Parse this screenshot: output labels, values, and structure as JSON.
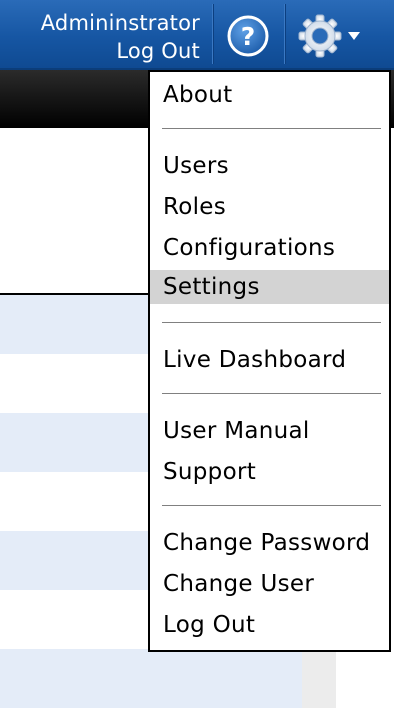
{
  "header": {
    "user_name": "Admininstrator",
    "logout_label": "Log Out",
    "help_icon": "help-icon",
    "settings_icon": "gear-icon",
    "dropdown_icon": "caret-down-icon",
    "accent_color": "#1656a3"
  },
  "menu": {
    "groups": [
      {
        "items": [
          {
            "label": "About"
          }
        ]
      },
      {
        "items": [
          {
            "label": "Users"
          },
          {
            "label": "Roles"
          },
          {
            "label": "Configurations"
          },
          {
            "label": "Settings",
            "selected": true
          }
        ]
      },
      {
        "items": [
          {
            "label": "Live Dashboard"
          }
        ]
      },
      {
        "items": [
          {
            "label": "User Manual"
          },
          {
            "label": "Support"
          }
        ]
      },
      {
        "items": [
          {
            "label": "Change Password"
          },
          {
            "label": "Change User"
          },
          {
            "label": "Log Out"
          }
        ]
      }
    ],
    "selected_color": "#d3d3d3"
  },
  "table": {
    "row_stripe_color": "#e4ecf8"
  }
}
